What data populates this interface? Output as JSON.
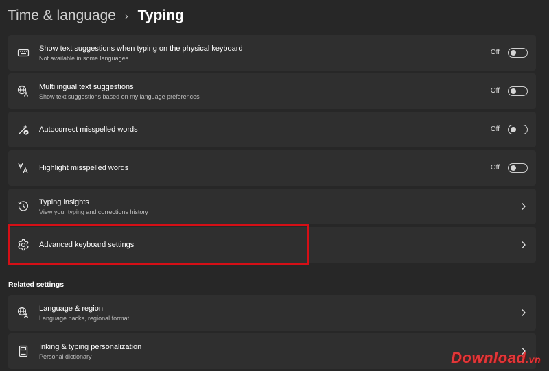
{
  "header": {
    "parent": "Time & language",
    "separator": "›",
    "current": "Typing"
  },
  "settings": [
    {
      "title": "Show text suggestions when typing on the physical keyboard",
      "subtitle": "Not available in some languages",
      "state": "Off",
      "icon": "keyboard-icon",
      "control": "toggle"
    },
    {
      "title": "Multilingual text suggestions",
      "subtitle": "Show text suggestions based on my language preferences",
      "state": "Off",
      "icon": "language-icon",
      "control": "toggle"
    },
    {
      "title": "Autocorrect misspelled words",
      "subtitle": "",
      "state": "Off",
      "icon": "autocorrect-icon",
      "control": "toggle"
    },
    {
      "title": "Highlight misspelled words",
      "subtitle": "",
      "state": "Off",
      "icon": "highlight-icon",
      "control": "toggle"
    },
    {
      "title": "Typing insights",
      "subtitle": "View your typing and corrections history",
      "icon": "history-icon",
      "control": "chevron"
    },
    {
      "title": "Advanced keyboard settings",
      "subtitle": "",
      "icon": "gear-icon",
      "control": "chevron",
      "highlighted": true
    }
  ],
  "related": {
    "label": "Related settings",
    "items": [
      {
        "title": "Language & region",
        "subtitle": "Language packs, regional format",
        "icon": "language-region-icon",
        "control": "chevron"
      },
      {
        "title": "Inking & typing personalization",
        "subtitle": "Personal dictionary",
        "icon": "dictionary-icon",
        "control": "chevron"
      }
    ]
  },
  "watermark": {
    "main": "Download",
    "tld": ".vn"
  },
  "colors": {
    "background": "#272727",
    "card": "#2f2f2f",
    "highlight": "#d50f16",
    "watermark": "#e0383a"
  }
}
